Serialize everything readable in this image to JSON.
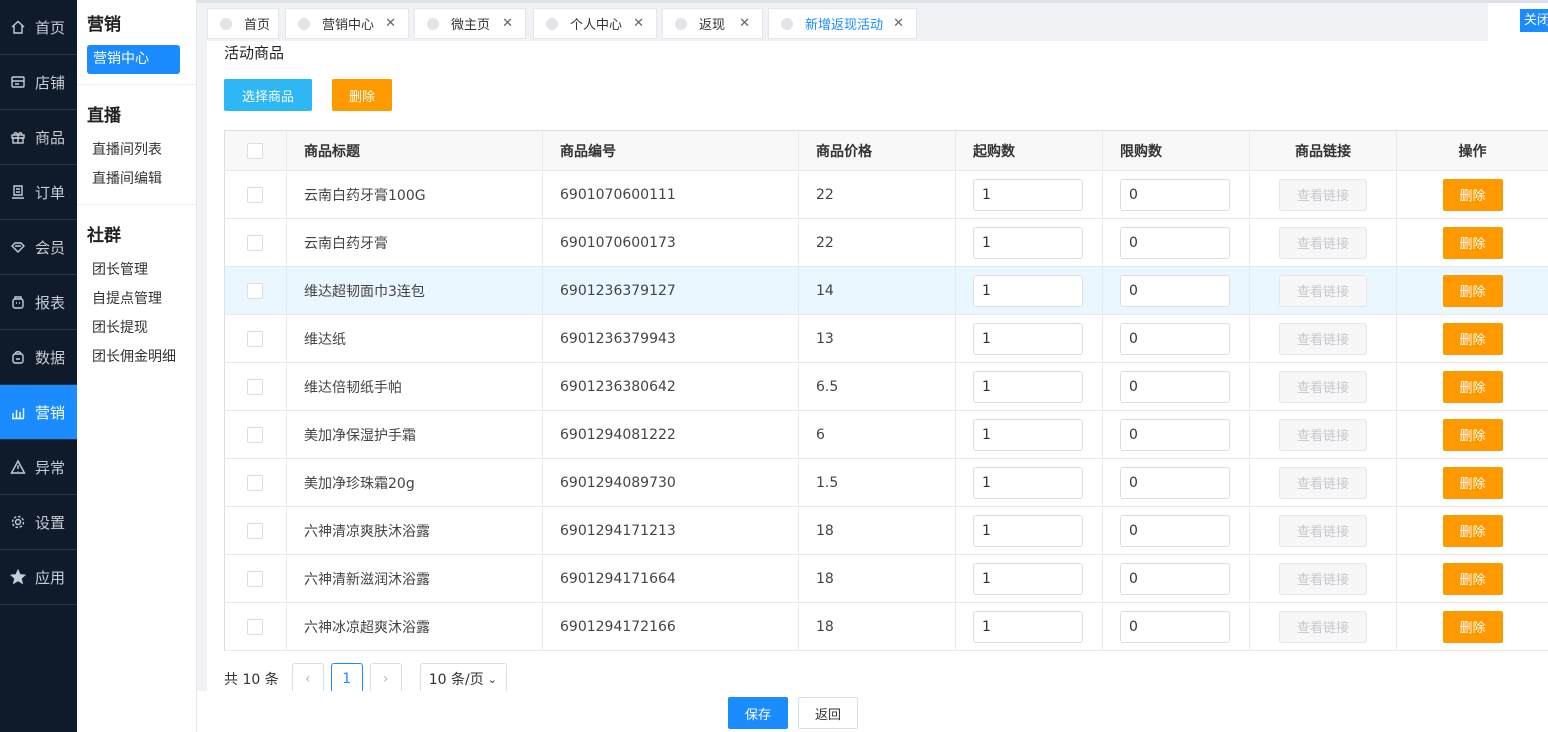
{
  "nav": [
    {
      "label": "首页",
      "icon": "home-icon"
    },
    {
      "label": "店铺",
      "icon": "store-icon"
    },
    {
      "label": "商品",
      "icon": "gift-icon"
    },
    {
      "label": "订单",
      "icon": "order-icon"
    },
    {
      "label": "会员",
      "icon": "member-icon"
    },
    {
      "label": "报表",
      "icon": "report-icon"
    },
    {
      "label": "数据",
      "icon": "data-icon"
    },
    {
      "label": "营销",
      "icon": "chart-bars-icon"
    },
    {
      "label": "异常",
      "icon": "warning-icon"
    },
    {
      "label": "设置",
      "icon": "gear-icon"
    },
    {
      "label": "应用",
      "icon": "star-icon"
    }
  ],
  "subnav": {
    "marketing_title": "营销",
    "marketing_center": "营销中心",
    "live_title": "直播",
    "live_items": [
      "直播间列表",
      "直播间编辑"
    ],
    "community_title": "社群",
    "community_items": [
      "团长管理",
      "自提点管理",
      "团长提现",
      "团长佣金明细"
    ]
  },
  "tabs": [
    {
      "label": "首页"
    },
    {
      "label": "营销中心"
    },
    {
      "label": "微主页"
    },
    {
      "label": "个人中心"
    },
    {
      "label": "返现"
    },
    {
      "label": "新增返现活动"
    }
  ],
  "close_all": "关闭",
  "section_title": "活动商品",
  "buttons": {
    "select_goods": "选择商品",
    "delete": "删除",
    "save": "保存",
    "back": "返回"
  },
  "table": {
    "headers": [
      "商品标题",
      "商品编号",
      "商品价格",
      "起购数",
      "限购数",
      "商品链接",
      "操作"
    ],
    "link_label": "查看链接",
    "delete_label": "删除",
    "rows": [
      {
        "title": "云南白药牙膏100G",
        "code": "6901070600111",
        "price": "22",
        "min": "1",
        "max": "0"
      },
      {
        "title": "云南白药牙膏",
        "code": "6901070600173",
        "price": "22",
        "min": "1",
        "max": "0"
      },
      {
        "title": "维达超韧面巾3连包",
        "code": "6901236379127",
        "price": "14",
        "min": "1",
        "max": "0"
      },
      {
        "title": "维达纸",
        "code": "6901236379943",
        "price": "13",
        "min": "1",
        "max": "0"
      },
      {
        "title": "维达倍韧纸手帕",
        "code": "6901236380642",
        "price": "6.5",
        "min": "1",
        "max": "0"
      },
      {
        "title": "美加净保湿护手霜",
        "code": "6901294081222",
        "price": "6",
        "min": "1",
        "max": "0"
      },
      {
        "title": "美加净珍珠霜20g",
        "code": "6901294089730",
        "price": "1.5",
        "min": "1",
        "max": "0"
      },
      {
        "title": "六神清凉爽肤沐浴露",
        "code": "6901294171213",
        "price": "18",
        "min": "1",
        "max": "0"
      },
      {
        "title": "六神清新滋润沐浴露",
        "code": "6901294171664",
        "price": "18",
        "min": "1",
        "max": "0"
      },
      {
        "title": "六神冰凉超爽沐浴露",
        "code": "6901294172166",
        "price": "18",
        "min": "1",
        "max": "0"
      }
    ]
  },
  "pager": {
    "total": "共 10 条",
    "page": "1",
    "size": "10 条/页"
  }
}
